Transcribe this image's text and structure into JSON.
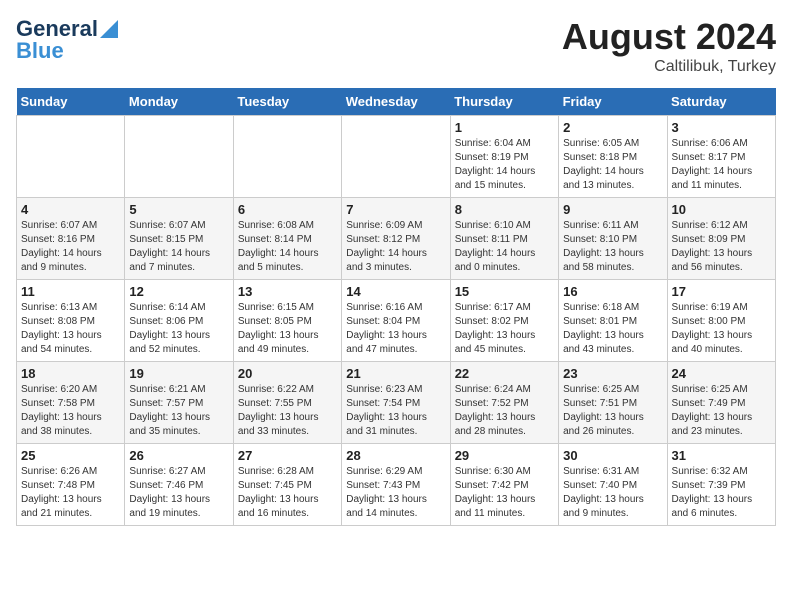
{
  "header": {
    "logo_general": "General",
    "logo_blue": "Blue",
    "month_year": "August 2024",
    "location": "Caltilibuk, Turkey"
  },
  "calendar": {
    "weekdays": [
      "Sunday",
      "Monday",
      "Tuesday",
      "Wednesday",
      "Thursday",
      "Friday",
      "Saturday"
    ],
    "weeks": [
      [
        {
          "day": "",
          "info": ""
        },
        {
          "day": "",
          "info": ""
        },
        {
          "day": "",
          "info": ""
        },
        {
          "day": "",
          "info": ""
        },
        {
          "day": "1",
          "info": "Sunrise: 6:04 AM\nSunset: 8:19 PM\nDaylight: 14 hours\nand 15 minutes."
        },
        {
          "day": "2",
          "info": "Sunrise: 6:05 AM\nSunset: 8:18 PM\nDaylight: 14 hours\nand 13 minutes."
        },
        {
          "day": "3",
          "info": "Sunrise: 6:06 AM\nSunset: 8:17 PM\nDaylight: 14 hours\nand 11 minutes."
        }
      ],
      [
        {
          "day": "4",
          "info": "Sunrise: 6:07 AM\nSunset: 8:16 PM\nDaylight: 14 hours\nand 9 minutes."
        },
        {
          "day": "5",
          "info": "Sunrise: 6:07 AM\nSunset: 8:15 PM\nDaylight: 14 hours\nand 7 minutes."
        },
        {
          "day": "6",
          "info": "Sunrise: 6:08 AM\nSunset: 8:14 PM\nDaylight: 14 hours\nand 5 minutes."
        },
        {
          "day": "7",
          "info": "Sunrise: 6:09 AM\nSunset: 8:12 PM\nDaylight: 14 hours\nand 3 minutes."
        },
        {
          "day": "8",
          "info": "Sunrise: 6:10 AM\nSunset: 8:11 PM\nDaylight: 14 hours\nand 0 minutes."
        },
        {
          "day": "9",
          "info": "Sunrise: 6:11 AM\nSunset: 8:10 PM\nDaylight: 13 hours\nand 58 minutes."
        },
        {
          "day": "10",
          "info": "Sunrise: 6:12 AM\nSunset: 8:09 PM\nDaylight: 13 hours\nand 56 minutes."
        }
      ],
      [
        {
          "day": "11",
          "info": "Sunrise: 6:13 AM\nSunset: 8:08 PM\nDaylight: 13 hours\nand 54 minutes."
        },
        {
          "day": "12",
          "info": "Sunrise: 6:14 AM\nSunset: 8:06 PM\nDaylight: 13 hours\nand 52 minutes."
        },
        {
          "day": "13",
          "info": "Sunrise: 6:15 AM\nSunset: 8:05 PM\nDaylight: 13 hours\nand 49 minutes."
        },
        {
          "day": "14",
          "info": "Sunrise: 6:16 AM\nSunset: 8:04 PM\nDaylight: 13 hours\nand 47 minutes."
        },
        {
          "day": "15",
          "info": "Sunrise: 6:17 AM\nSunset: 8:02 PM\nDaylight: 13 hours\nand 45 minutes."
        },
        {
          "day": "16",
          "info": "Sunrise: 6:18 AM\nSunset: 8:01 PM\nDaylight: 13 hours\nand 43 minutes."
        },
        {
          "day": "17",
          "info": "Sunrise: 6:19 AM\nSunset: 8:00 PM\nDaylight: 13 hours\nand 40 minutes."
        }
      ],
      [
        {
          "day": "18",
          "info": "Sunrise: 6:20 AM\nSunset: 7:58 PM\nDaylight: 13 hours\nand 38 minutes."
        },
        {
          "day": "19",
          "info": "Sunrise: 6:21 AM\nSunset: 7:57 PM\nDaylight: 13 hours\nand 35 minutes."
        },
        {
          "day": "20",
          "info": "Sunrise: 6:22 AM\nSunset: 7:55 PM\nDaylight: 13 hours\nand 33 minutes."
        },
        {
          "day": "21",
          "info": "Sunrise: 6:23 AM\nSunset: 7:54 PM\nDaylight: 13 hours\nand 31 minutes."
        },
        {
          "day": "22",
          "info": "Sunrise: 6:24 AM\nSunset: 7:52 PM\nDaylight: 13 hours\nand 28 minutes."
        },
        {
          "day": "23",
          "info": "Sunrise: 6:25 AM\nSunset: 7:51 PM\nDaylight: 13 hours\nand 26 minutes."
        },
        {
          "day": "24",
          "info": "Sunrise: 6:25 AM\nSunset: 7:49 PM\nDaylight: 13 hours\nand 23 minutes."
        }
      ],
      [
        {
          "day": "25",
          "info": "Sunrise: 6:26 AM\nSunset: 7:48 PM\nDaylight: 13 hours\nand 21 minutes."
        },
        {
          "day": "26",
          "info": "Sunrise: 6:27 AM\nSunset: 7:46 PM\nDaylight: 13 hours\nand 19 minutes."
        },
        {
          "day": "27",
          "info": "Sunrise: 6:28 AM\nSunset: 7:45 PM\nDaylight: 13 hours\nand 16 minutes."
        },
        {
          "day": "28",
          "info": "Sunrise: 6:29 AM\nSunset: 7:43 PM\nDaylight: 13 hours\nand 14 minutes."
        },
        {
          "day": "29",
          "info": "Sunrise: 6:30 AM\nSunset: 7:42 PM\nDaylight: 13 hours\nand 11 minutes."
        },
        {
          "day": "30",
          "info": "Sunrise: 6:31 AM\nSunset: 7:40 PM\nDaylight: 13 hours\nand 9 minutes."
        },
        {
          "day": "31",
          "info": "Sunrise: 6:32 AM\nSunset: 7:39 PM\nDaylight: 13 hours\nand 6 minutes."
        }
      ]
    ]
  }
}
